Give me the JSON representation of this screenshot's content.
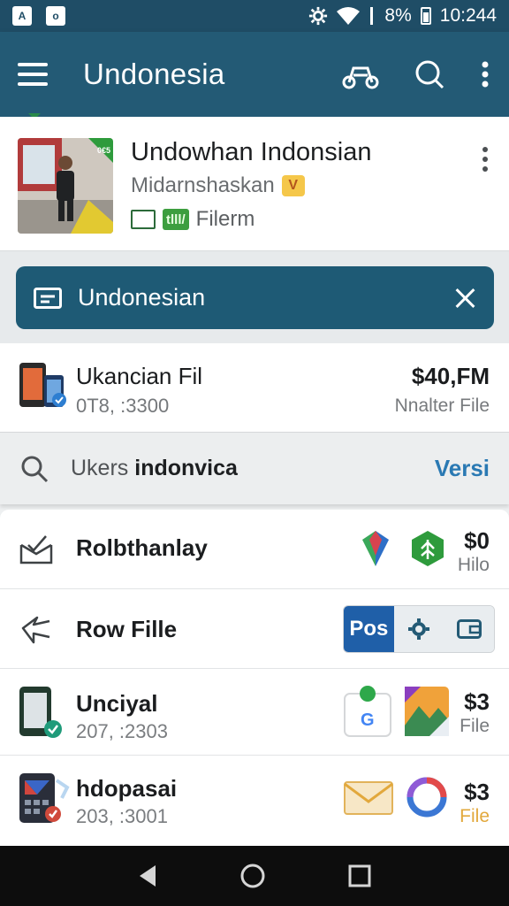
{
  "status_bar": {
    "time": "10:244",
    "battery": "8%",
    "left_icons": [
      "A",
      "o"
    ]
  },
  "app_bar": {
    "title": "Undonesia",
    "icons": [
      "menu-icon",
      "scooter-icon",
      "search-icon",
      "overflow-icon"
    ]
  },
  "profile": {
    "name": "Undowhan Indonsian",
    "subtitle": "Midarnshaskan",
    "badge": "V",
    "pill": "tlll/",
    "meta_label": "Filerm",
    "photo_tag": "0€5"
  },
  "banner": {
    "label": "Undonesian"
  },
  "featured": {
    "title": "Ukancian Fil",
    "subtitle": "0T8, :3300",
    "price": "$40,FM",
    "price_sub": "Nnalter File"
  },
  "search": {
    "prefix": "Ukers",
    "query": "indonvica",
    "action": "Versi"
  },
  "rows": [
    {
      "title": "Rolbthanlay",
      "price": "$0",
      "price_sub": "Hilo"
    },
    {
      "title": "Row Fille",
      "segment_active": "Pos"
    },
    {
      "title": "Unciyal",
      "subtitle": "207, :2303",
      "price": "$3",
      "price_sub": "File"
    },
    {
      "title": "hdopasai",
      "subtitle": "203, :3001",
      "price": "$3",
      "price_sub": "File"
    }
  ],
  "colors": {
    "appbar": "#235a75",
    "banner": "#1e5a75",
    "accent": "#2a79b3",
    "status_bar": "#1f4d66"
  }
}
